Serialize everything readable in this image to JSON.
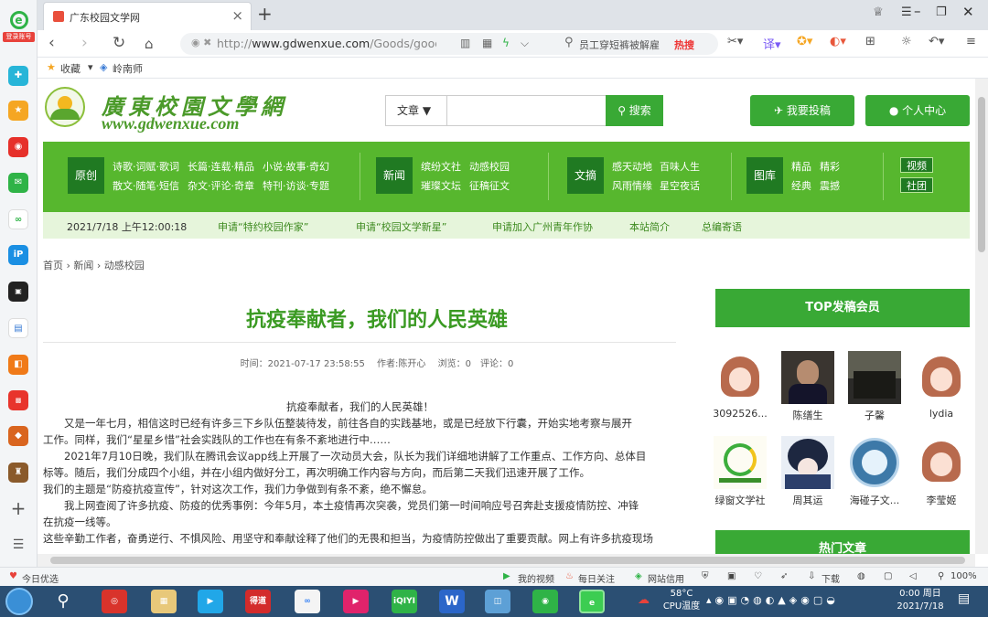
{
  "browser": {
    "tab_title": "广东校园文学网",
    "url_prefix": "http://",
    "url_domain": "www.gdwenxue.com",
    "url_path": "/Goods/goodsInfo",
    "search_text": "员工穿短裤被解雇",
    "search_hot": "热搜",
    "login_label": "登录账号",
    "bookmark_fav": "收藏",
    "bookmark_1": "岭南师"
  },
  "site": {
    "name": "廣東校園文學網",
    "url": "www.gdwenxue.com",
    "search_category": "文章",
    "search_button": "搜索",
    "submit_button": "我要投稿",
    "user_center": "个人中心"
  },
  "nav": {
    "groups": [
      {
        "cat": "原创",
        "links": [
          "诗歌·词赋·歌词",
          "长篇·连载·精品",
          "小说·故事·奇幻",
          "散文·随笔·短信",
          "杂文·评论·奇章",
          "特刊·访谈·专题"
        ]
      },
      {
        "cat": "新闻",
        "links": [
          "缤纷文社",
          "动感校园",
          "璀璨文坛",
          "征稿征文"
        ]
      },
      {
        "cat": "文摘",
        "links": [
          "感天动地",
          "百味人生",
          "风雨情缘",
          "星空夜话"
        ]
      },
      {
        "cat": "图库",
        "links": [
          "精品",
          "精彩",
          "经典",
          "震撼"
        ]
      }
    ],
    "pills": [
      "视频",
      "社团"
    ]
  },
  "subnav": [
    "2021/7/18 上午12:00:18",
    "申请“特约校园作家”",
    "申请“校园文学新星”",
    "申请加入广州青年作协",
    "本站简介",
    "总编寄语"
  ],
  "breadcrumb": {
    "home": "首页",
    "news": "新闻",
    "current": "动感校园"
  },
  "article": {
    "title": "抗疫奉献者，我们的人民英雄",
    "meta": "时间：2021-07-17 23:58:55　 作者:陈开心　 浏览：0　评论：0",
    "body_title": "抗疫奉献者，我们的人民英雄！",
    "paragraphs": [
      "　　又是一年七月，相信这时已经有许多三下乡队伍整装待发，前往各自的实践基地，或是已经放下行囊，开始实地考察与展开",
      "工作。同样，我们“星星乡惜”社会实践队的工作也在有条不紊地进行中……",
      "　　2021年7月10日晚，我们队在腾讯会议app线上开展了一次动员大会，队长为我们详细地讲解了工作重点、工作方向、总体目",
      "标等。随后，我们分成四个小组，并在小组内做好分工，再次明确工作内容与方向，而后第二天我们迅速开展了工作。",
      "我们的主题是“防疫抗疫宣传”，针对这次工作，我们力争做到有条不紊，绝不懈怠。",
      "　　我上网查阅了许多抗疫、防疫的优秀事例：今年5月，本土疫情再次突袭，党员们第一时间响应号召奔赴支援疫情防控、冲锋",
      "在抗疫一线等。",
      "这些辛勤工作者，奋勇逆行、不惧风险、用坚守和奉献诠释了他们的无畏和担当，为疫情防控做出了重要贡献。网上有许多抗疫现场"
    ]
  },
  "sidebar": {
    "top_title": "TOP发稿会员",
    "members": [
      "3092526...",
      "陈缮生",
      "子馨",
      "lydia",
      "绿窗文学社",
      "周其运",
      "海碰子文...",
      "李莹姬"
    ],
    "hot_title": "热门文章"
  },
  "status_bar": {
    "left": "今日优选",
    "video": "我的视频",
    "follow": "每日关注",
    "credit": "网站信用",
    "download": "下载",
    "zoom": "100%"
  },
  "taskbar": {
    "weather_temp": "58°C",
    "weather_label": "CPU温度",
    "time": "0:00 周日",
    "date": "2021/7/18",
    "apps": [
      "得道",
      "iQIYI",
      "W"
    ]
  }
}
